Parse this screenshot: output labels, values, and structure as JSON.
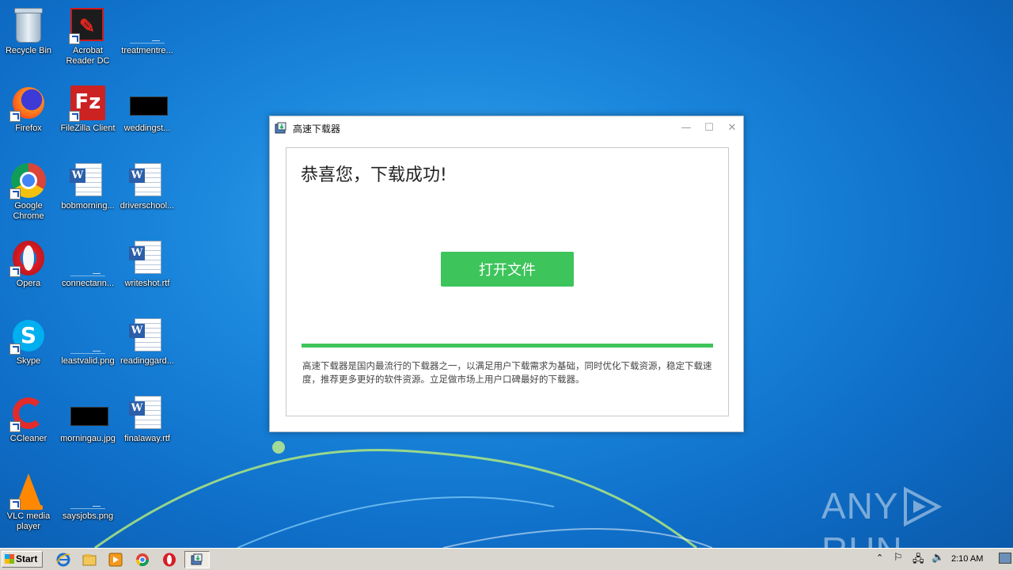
{
  "desktop": {
    "icons": [
      {
        "label1": "Recycle Bin",
        "label2": ""
      },
      {
        "label1": "Acrobat",
        "label2": "Reader DC"
      },
      {
        "label1": "treatmentre...",
        "label2": ""
      },
      {
        "label1": "Firefox",
        "label2": ""
      },
      {
        "label1": "FileZilla Client",
        "label2": ""
      },
      {
        "label1": "weddingst...",
        "label2": ""
      },
      {
        "label1": "Google",
        "label2": "Chrome"
      },
      {
        "label1": "bobmorning...",
        "label2": ""
      },
      {
        "label1": "driverschool...",
        "label2": ""
      },
      {
        "label1": "Opera",
        "label2": ""
      },
      {
        "label1": "connectann...",
        "label2": ""
      },
      {
        "label1": "writeshot.rtf",
        "label2": ""
      },
      {
        "label1": "Skype",
        "label2": ""
      },
      {
        "label1": "leastvalid.png",
        "label2": ""
      },
      {
        "label1": "readinggard...",
        "label2": ""
      },
      {
        "label1": "CCleaner",
        "label2": ""
      },
      {
        "label1": "morningau.jpg",
        "label2": ""
      },
      {
        "label1": "finalaway.rtf",
        "label2": ""
      },
      {
        "label1": "VLC media",
        "label2": "player"
      },
      {
        "label1": "saysjobs.png",
        "label2": ""
      }
    ]
  },
  "dialog": {
    "title": "高速下载器",
    "headline": "恭喜您，下载成功!",
    "open_button": "打开文件",
    "progress_fraction": 1.0,
    "description": "高速下载器是国内最流行的下载器之一，以满足用户下载需求为基础，同时优化下载资源，稳定下载速度，推荐更多更好的软件资源。立足做市场上用户口碑最好的下载器。",
    "accent": "#3dc45b"
  },
  "watermark": {
    "left": "ANY",
    "right": "RUN"
  },
  "taskbar": {
    "start_label": "Start",
    "clock": "2:10 AM"
  }
}
